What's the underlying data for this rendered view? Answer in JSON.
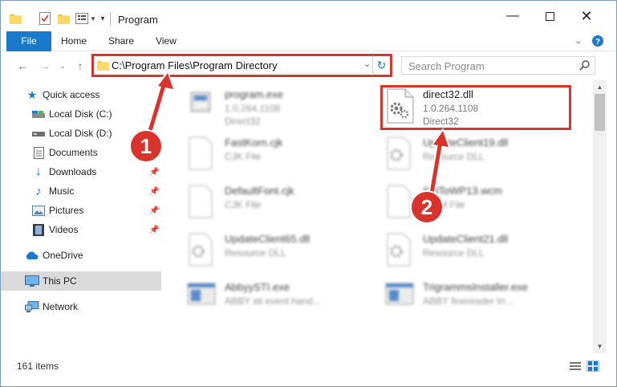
{
  "window": {
    "title": "Program",
    "controls": {
      "minimize_icon": "minimize-icon",
      "maximize_icon": "maximize-icon",
      "close_icon": "close-icon"
    }
  },
  "ribbon": {
    "tabs": [
      {
        "label": "File",
        "active": true
      },
      {
        "label": "Home"
      },
      {
        "label": "Share"
      },
      {
        "label": "View"
      }
    ]
  },
  "address": {
    "path": "C:\\Program Files\\Program Directory"
  },
  "search": {
    "placeholder": "Search Program"
  },
  "sidebar": {
    "items": [
      {
        "label": "Quick access",
        "icon": "star-icon"
      },
      {
        "label": "Local Disk (C:)",
        "icon": "drive-icon"
      },
      {
        "label": "Local Disk (D:)",
        "icon": "drive-icon"
      },
      {
        "label": "Documents",
        "icon": "documents-icon",
        "pinned": true
      },
      {
        "label": "Downloads",
        "icon": "downloads-icon",
        "pinned": true
      },
      {
        "label": "Music",
        "icon": "music-icon",
        "pinned": true
      },
      {
        "label": "Pictures",
        "icon": "pictures-icon",
        "pinned": true
      },
      {
        "label": "Videos",
        "icon": "videos-icon",
        "pinned": true
      },
      {
        "label": "OneDrive",
        "icon": "cloud-icon"
      },
      {
        "label": "This PC",
        "icon": "computer-icon",
        "selected": true
      },
      {
        "label": "Network",
        "icon": "network-icon"
      }
    ]
  },
  "files": [
    {
      "name": "program.exe",
      "line1": "1.0.264.1108",
      "line2": "Direct32",
      "icon": "exe-icon"
    },
    {
      "name": "direct32.dll",
      "line1": "1.0.264.1108",
      "line2": "Direct32",
      "icon": "dll-gear-icon",
      "highlighted": true
    },
    {
      "name": "FastKorn.cjk",
      "line1": "CJK File",
      "line2": "",
      "icon": "file-icon"
    },
    {
      "name": "UpdateClient19.dll",
      "line1": "Resource DLL",
      "line2": "",
      "icon": "dll-gear-icon"
    },
    {
      "name": "DefaultFont.cjk",
      "line1": "CJK File",
      "line2": "",
      "icon": "file-icon"
    },
    {
      "name": "SetToWP13.wcm",
      "line1": "WCM File",
      "line2": "",
      "icon": "file-icon"
    },
    {
      "name": "UpdateClient65.dll",
      "line1": "Resource DLL",
      "line2": "",
      "icon": "dll-gear-icon"
    },
    {
      "name": "UpdateClient21.dll",
      "line1": "Resource DLL",
      "line2": "",
      "icon": "dll-gear-icon"
    },
    {
      "name": "AbbyySTI.exe",
      "line1": "ABBY sti event hand...",
      "line2": "",
      "icon": "app-window-icon"
    },
    {
      "name": "TrigrammsInstaller.exe",
      "line1": "ABBY finereader tri...",
      "line2": "",
      "icon": "app-window-icon"
    }
  ],
  "status": {
    "item_count": "161 items"
  },
  "annotations": [
    {
      "number": "1",
      "color": "#d9342b"
    },
    {
      "number": "2",
      "color": "#d9342b"
    }
  ],
  "colors": {
    "accent": "#1979ca",
    "highlight": "#d9342b",
    "selection": "#dadada"
  }
}
